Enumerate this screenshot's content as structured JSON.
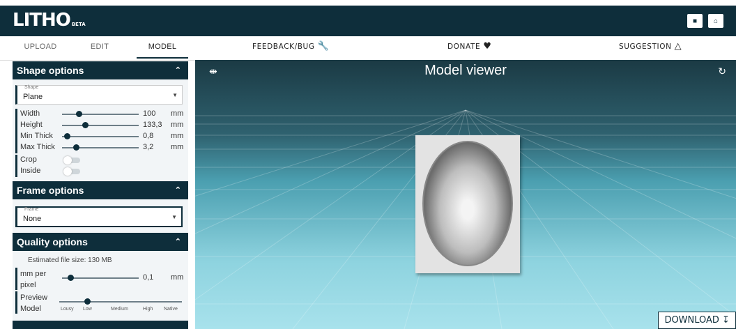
{
  "app": {
    "logo": "LITHO",
    "logo_badge": "BETA"
  },
  "nav": {
    "tabs": [
      "UPLOAD",
      "EDIT",
      "MODEL"
    ],
    "links": [
      {
        "label": "FEEDBACK/BUG",
        "icon": "wrench-icon"
      },
      {
        "label": "DONATE",
        "icon": "heart-icon"
      },
      {
        "label": "SUGGESTION",
        "icon": "lightbulb-icon"
      }
    ]
  },
  "shape": {
    "title": "Shape options",
    "select_label": "Shape",
    "select_value": "Plane",
    "params": [
      {
        "name": "Width",
        "value": "100",
        "unit": "mm",
        "level": 0.3
      },
      {
        "name": "Height",
        "value": "133,3",
        "unit": "mm",
        "level": 0.4
      },
      {
        "name": "Min Thick",
        "value": "0,8",
        "unit": "mm",
        "level": 0.05
      },
      {
        "name": "Max Thick",
        "value": "3,2",
        "unit": "mm",
        "level": 0.2
      }
    ],
    "toggles": [
      "Crop",
      "Inside"
    ]
  },
  "frame": {
    "title": "Frame options",
    "select_label": "Frame",
    "select_value": "None"
  },
  "quality": {
    "title": "Quality options",
    "file_size": "Estimated file size: 130 MB",
    "mm_per_pixel_label_1": "mm per",
    "mm_per_pixel_label_2": "pixel",
    "mm_per_pixel_value": "0,1",
    "mm_per_pixel_unit": "mm",
    "preview_label_1": "Preview",
    "preview_label_2": "Model",
    "preview_levels": [
      "Lousy",
      "Low",
      "Medium",
      "High",
      "Native"
    ],
    "preview_selected": "Low"
  },
  "viewer": {
    "title": "Model viewer"
  },
  "download": {
    "label": "DOWNLOAD"
  },
  "colors": {
    "primary": "#0e2e3b",
    "accent": "#8ed3df"
  }
}
